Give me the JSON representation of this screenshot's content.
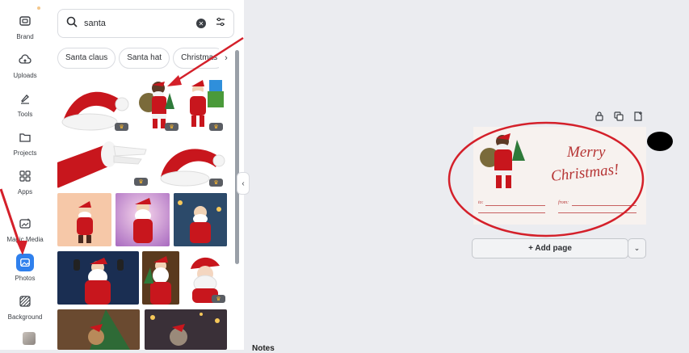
{
  "sidebar": {
    "items": [
      {
        "label": "Brand",
        "icon": "brand-icon"
      },
      {
        "label": "Uploads",
        "icon": "cloud-upload-icon"
      },
      {
        "label": "Tools",
        "icon": "pen-tool-icon"
      },
      {
        "label": "Projects",
        "icon": "folder-icon"
      },
      {
        "label": "Apps",
        "icon": "apps-grid-icon"
      },
      {
        "label": "Magic Media",
        "icon": "magic-media-icon"
      },
      {
        "label": "Photos",
        "icon": "photo-icon"
      },
      {
        "label": "Background",
        "icon": "background-pattern-icon"
      }
    ],
    "active": "Photos"
  },
  "search": {
    "value": "santa",
    "icons": [
      "search-icon",
      "clear-icon",
      "filter-sliders-icon"
    ]
  },
  "chips": [
    "Santa claus",
    "Santa hat",
    "Christmas"
  ],
  "canvas": {
    "toolbar_icons": [
      "lock-icon",
      "duplicate-icon",
      "add-page-icon"
    ],
    "card": {
      "greeting_line1": "Merry",
      "greeting_line2": "Christmas!",
      "to_label": "to:",
      "from_label": "from:"
    },
    "add_page_label": "+ Add page",
    "notes_label": "Notes"
  },
  "colors": {
    "accent": "#2f80ed",
    "annotation": "#d4202a",
    "card_text": "#b63535"
  }
}
